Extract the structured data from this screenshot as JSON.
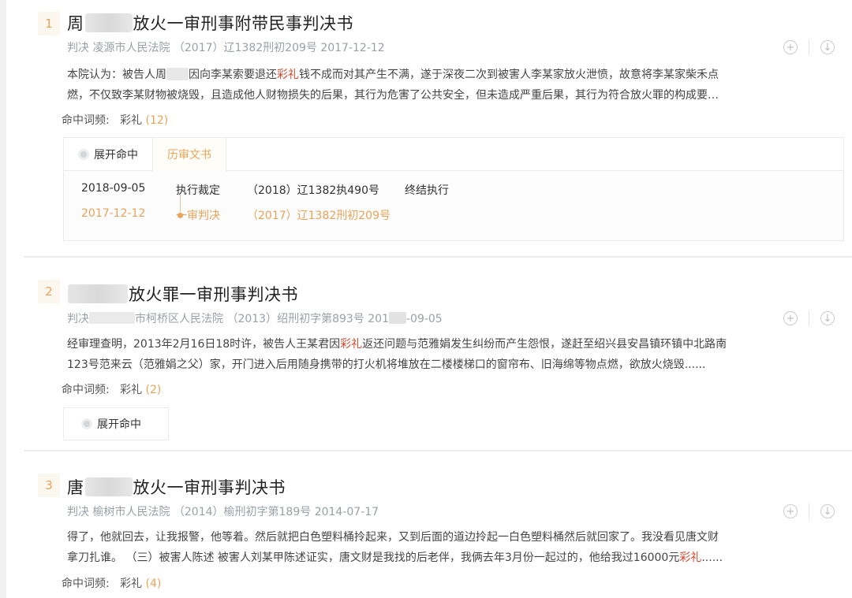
{
  "results": [
    {
      "index": "1",
      "title_pre": "周",
      "title_post": "放火一审刑事附带民事判决书",
      "meta": "判决 凌源市人民法院 （2017）辽1382刑初209号 2017-12-12",
      "abstract_line1_a": "本院认为：被告人周",
      "abstract_line1_b": "因向李某索要退还",
      "highlight": "彩礼",
      "abstract_line1_c": "钱不成而对其产生不满，遂于深夜二次到被害人李某家放火泄愤，故意将李某家柴禾点",
      "abstract_line2": "燃，不仅致李某财物被烧毁，且造成他人财物损失的后果，其行为危害了公共安全，但未造成严重后果，其行为符合放火罪的构成要…",
      "freq_label": "命中词频:",
      "freq_word": "彩礼",
      "freq_count": "(12)",
      "tabs": [
        "展开命中",
        "历审文书"
      ],
      "timeline": [
        {
          "date": "2018-09-05",
          "type": "执行裁定",
          "case": "（2018）辽1382执490号",
          "status": "终结执行"
        },
        {
          "date": "2017-12-12",
          "type": "一审判决",
          "case": "（2017）辽1382刑初209号",
          "status": ""
        }
      ]
    },
    {
      "index": "2",
      "title_post": "放火罪一审刑事判决书",
      "meta_a": "判决",
      "meta_b": "市柯桥区人民法院 （2013）绍刑初字第893号 201",
      "meta_c": "-09-05",
      "abstract_line1_a": "经审理查明，2013年2月16日18时许，被告人王某君因",
      "highlight": "彩礼",
      "abstract_line1_b": "返还问题与范雅娟发生纠纷而产生怨恨，遂赶至绍兴县安昌镇环镇中北路南",
      "abstract_line2": "123号范来云（范雅娟之父）家，开门进入后用随身携带的打火机将堆放在二楼楼梯口的窗帘布、旧海绵等物点燃，欲放火烧毁......",
      "freq_label": "命中词频:",
      "freq_word": "彩礼",
      "freq_count": "(2)",
      "tabs": [
        "展开命中"
      ]
    },
    {
      "index": "3",
      "title_pre": "唐",
      "title_post": "放火一审刑事判决书",
      "meta": "判决 榆树市人民法院 （2014）榆刑初字第189号 2014-07-17",
      "abstract_line1": "得了，他就回去，让我报警，他等着。然后就把白色塑料桶拎起来，又到后面的道边拎起一白色塑料桶然后就回家了。我没看见唐文财",
      "abstract_line2_a": "拿刀扎谁。 （三）被害人陈述 被害人刘某甲陈述证实，唐文财是我找的后老伴，我俩去年3月份一起过的，他给我过16000元",
      "highlight": "彩礼",
      "abstract_line2_b": "......",
      "freq_label": "命中词频:",
      "freq_word": "彩礼",
      "freq_count": "(4)"
    }
  ],
  "icons": {
    "add": "plus-circle-icon",
    "download": "download-circle-icon"
  },
  "colors": {
    "accent": "#e8a35a",
    "highlight": "#d04a2f",
    "meta": "#9aa0a8"
  }
}
